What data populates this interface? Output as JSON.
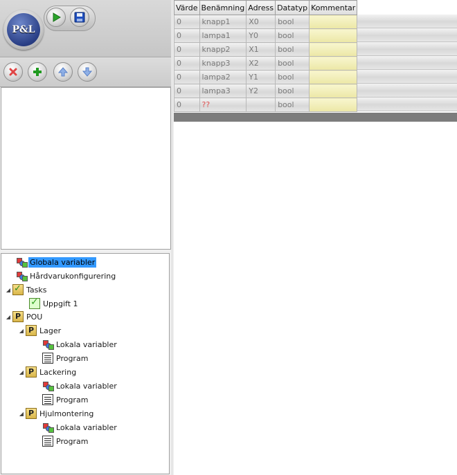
{
  "app": {
    "logo_text": "P&L"
  },
  "toolbar": {
    "run_icon": "play-icon",
    "save_icon": "floppy-disk-icon",
    "delete_icon": "delete-x-icon",
    "add_icon": "plus-icon",
    "up_icon": "arrow-up-icon",
    "down_icon": "arrow-down-icon"
  },
  "tree": {
    "items": [
      {
        "label": "Globala variabler",
        "icon": "variables-icon",
        "selected": true
      },
      {
        "label": "Hårdvarukonfigurering",
        "icon": "variables-icon"
      },
      {
        "label": "Tasks",
        "icon": "folder-check-icon",
        "expanded": true
      },
      {
        "label": "Uppgift 1",
        "icon": "task-check-icon"
      },
      {
        "label": "POU",
        "icon": "folder-p-icon",
        "expanded": true
      },
      {
        "label": "Lager",
        "icon": "folder-p-icon",
        "expanded": true
      },
      {
        "label": "Lokala variabler",
        "icon": "variables-icon"
      },
      {
        "label": "Program",
        "icon": "program-icon"
      },
      {
        "label": "Lackering",
        "icon": "folder-p-icon",
        "expanded": true
      },
      {
        "label": "Lokala variabler",
        "icon": "variables-icon"
      },
      {
        "label": "Program",
        "icon": "program-icon"
      },
      {
        "label": "Hjulmontering",
        "icon": "folder-p-icon",
        "expanded": true
      },
      {
        "label": "Lokala variabler",
        "icon": "variables-icon"
      },
      {
        "label": "Program",
        "icon": "program-icon"
      }
    ]
  },
  "grid": {
    "columns": [
      "Värde",
      "Benämning",
      "Adress",
      "Datatyp",
      "Kommentar"
    ],
    "rows": [
      [
        "0",
        "knapp1",
        "X0",
        "bool",
        ""
      ],
      [
        "0",
        "lampa1",
        "Y0",
        "bool",
        ""
      ],
      [
        "0",
        "knapp2",
        "X1",
        "bool",
        ""
      ],
      [
        "0",
        "knapp3",
        "X2",
        "bool",
        ""
      ],
      [
        "0",
        "lampa2",
        "Y1",
        "bool",
        ""
      ],
      [
        "0",
        "lampa3",
        "Y2",
        "bool",
        ""
      ],
      [
        "0",
        "??",
        "",
        "bool",
        ""
      ]
    ],
    "colors": {
      "comment_cell": "#f8f6cf",
      "error_text": "#e05050",
      "footer_bar": "#7c7c7c"
    }
  }
}
